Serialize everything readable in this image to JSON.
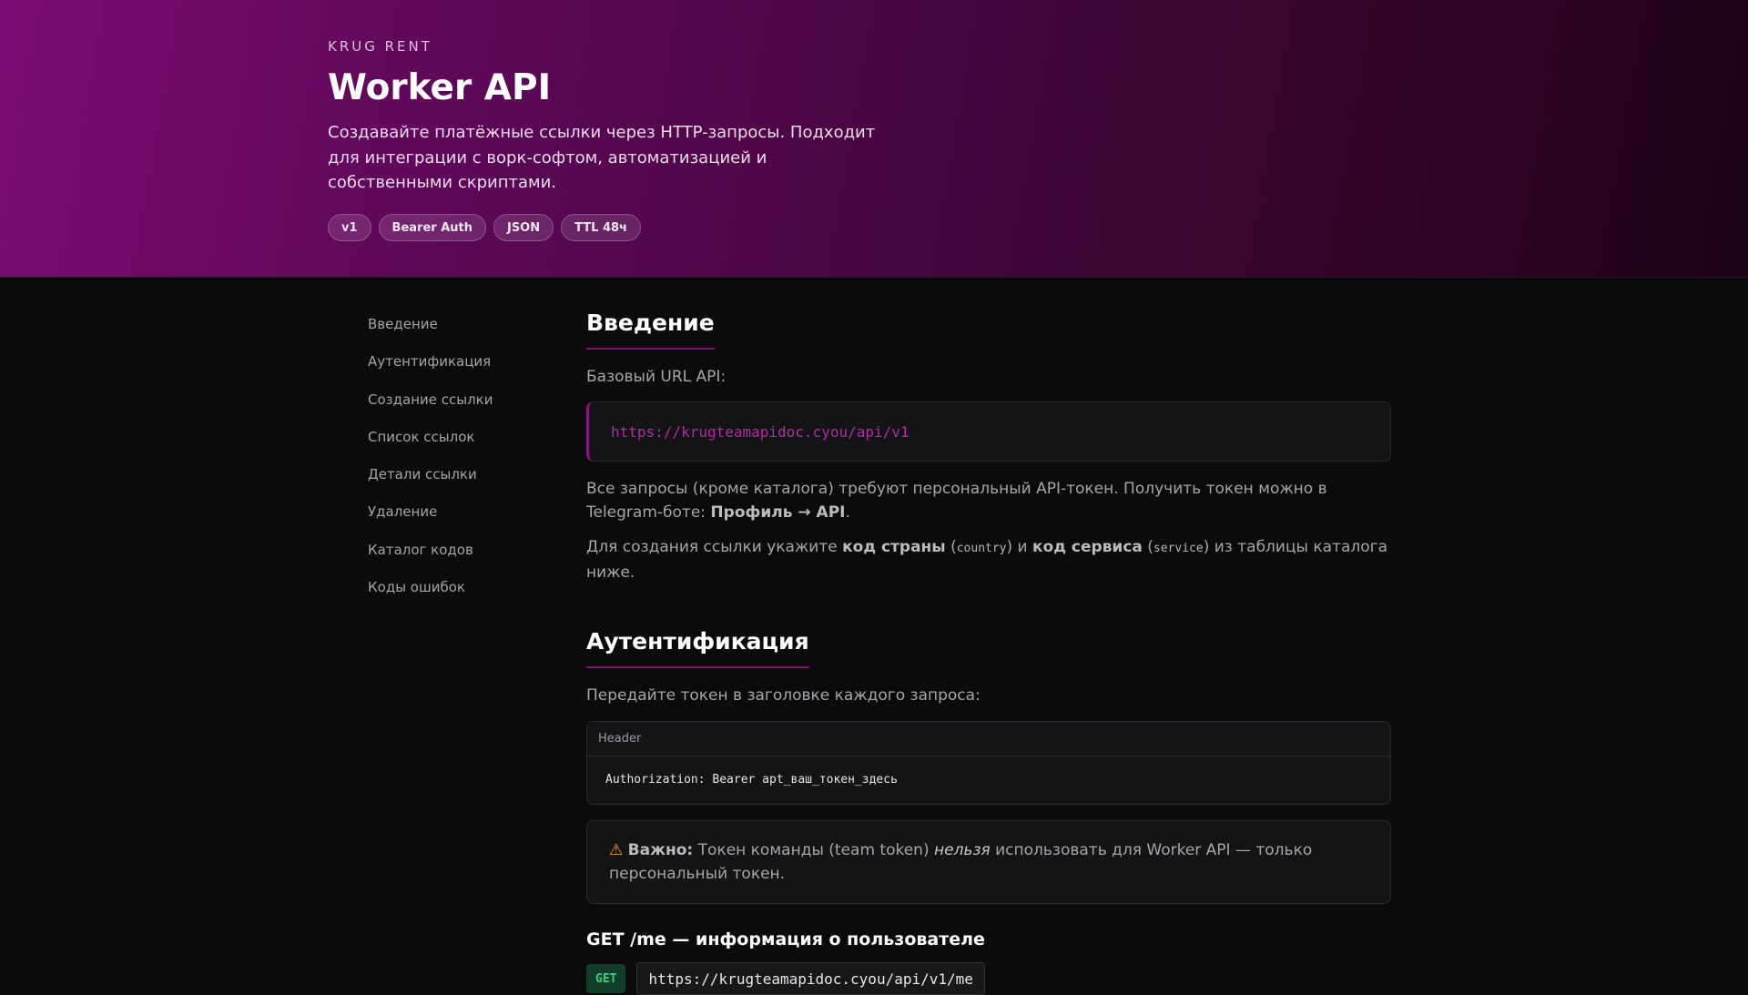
{
  "hero": {
    "brand": "KRUG RENT",
    "title": "Worker API",
    "description": "Создавайте платёжные ссылки через HTTP-запросы. Подходит для интеграции с ворк-софтом, автоматизацией и собственными скриптами.",
    "tags": [
      "v1",
      "Bearer Auth",
      "JSON",
      "TTL 48ч"
    ]
  },
  "sidebar": {
    "items": [
      {
        "label": "Введение"
      },
      {
        "label": "Аутентификация"
      },
      {
        "label": "Создание ссылки"
      },
      {
        "label": "Список ссылок"
      },
      {
        "label": "Детали ссылки"
      },
      {
        "label": "Удаление"
      },
      {
        "label": "Каталог кодов"
      },
      {
        "label": "Коды ошибок"
      }
    ]
  },
  "intro": {
    "title": "Введение",
    "base_url_label": "Базовый URL API:",
    "base_url": "https://krugteamapidoc.cyou/api/v1",
    "p1_text": "Все запросы (кроме каталога) требуют персональный API-токен. Получить токен можно в Telegram-боте: ",
    "p1_strong": "Профиль → API",
    "p1_end": ".",
    "p2_text1": "Для создания ссылки укажите ",
    "p2_strong1": "код страны",
    "p2_code1_open": " (",
    "p2_code1": "country",
    "p2_code1_close": ") и ",
    "p2_strong2": "код сервиса",
    "p2_code2_open": " (",
    "p2_code2": "service",
    "p2_text2": ") из таблицы каталога ниже."
  },
  "auth": {
    "title": "Аутентификация",
    "description": "Передайте токен в заголовке каждого запроса:",
    "header_label": "Header",
    "header_code": "Authorization: Bearer apt_ваш_токен_здесь",
    "warning_icon": "⚠",
    "warning_strong": "Важно:",
    "warning_text1": " Токен команды (team token) ",
    "warning_em": "нельзя",
    "warning_text2": " использовать для Worker API — только персональный токен."
  },
  "endpoint_me": {
    "title": "GET /me — информация о пользователе",
    "method": "GET",
    "url": "https://krugteamapidoc.cyou/api/v1/me"
  }
}
